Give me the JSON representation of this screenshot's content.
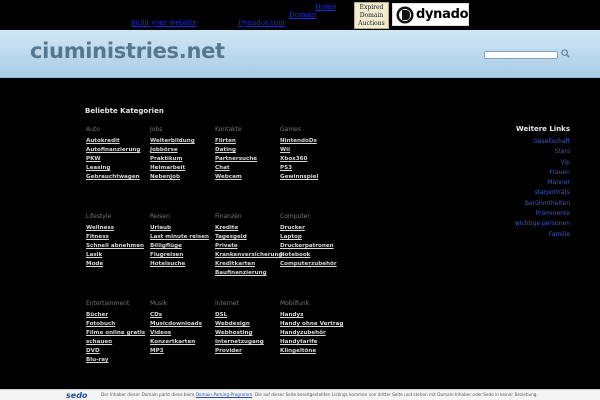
{
  "topbar": {
    "build_link": "build your website",
    "dynadot_link": "Dynadot.com",
    "home_link": "Home",
    "parked_link": "Domain",
    "expired_badge": [
      "Expired",
      "Domain",
      "Auctions"
    ],
    "logo_text": "dynadot"
  },
  "header": {
    "site_title": "ciuministries.net",
    "search_placeholder": ""
  },
  "main": {
    "section_title": "Beliebte Kategorien",
    "rows": [
      [
        {
          "head": "Auto",
          "links": [
            "Autokredit",
            "Autofinanzierung",
            "PKW",
            "Leasing",
            "Gebrauchtwagen"
          ]
        },
        {
          "head": "Jobs",
          "links": [
            "Weiterbildung",
            "Jobbörse",
            "Praktikum",
            "Heimarbeit",
            "Nebenjob"
          ]
        },
        {
          "head": "Kontakte",
          "links": [
            "Flirten",
            "Dating",
            "Partnersuche",
            "Chat",
            "Webcam"
          ]
        },
        {
          "head": "Games",
          "links": [
            "NintendoDs",
            "Wii",
            "Xbox360",
            "PS3",
            "Gewinnspiel"
          ]
        }
      ],
      [
        {
          "head": "Lifestyle",
          "links": [
            "Wellness",
            "Fitness",
            "Schnell abnehmen",
            "Lasik",
            "Mode"
          ]
        },
        {
          "head": "Reisen",
          "links": [
            "Urlaub",
            "Last minute reisen",
            "Billigflüge",
            "Flugreisen",
            "Hotelsuche"
          ]
        },
        {
          "head": "Finanzen",
          "links": [
            "Kredite",
            "Tagesgeld",
            "Private",
            "Krankenversicherung",
            "Kreditkarten",
            "Baufinanzierung"
          ]
        },
        {
          "head": "Computer",
          "links": [
            "Drucker",
            "Laptop",
            "Druckerpatronen",
            "Notebook",
            "Computerzubehör"
          ]
        }
      ],
      [
        {
          "head": "Entertainment",
          "links": [
            "Bücher",
            "Fotobuch",
            "Filme online gratis",
            "schauen",
            "DVD",
            "Blu-ray"
          ]
        },
        {
          "head": "Musik",
          "links": [
            "CDs",
            "Musicdownloads",
            "Videos",
            "Konzertkarten",
            "MP3"
          ]
        },
        {
          "head": "Internet",
          "links": [
            "DSL",
            "Webdesign",
            "Webhosting",
            "Internetzugang",
            "Provider"
          ]
        },
        {
          "head": "Mobilfunk",
          "links": [
            "Handys",
            "Handy ohne Vertrag",
            "Handyzubehör",
            "Handytarife",
            "Klingeltöne"
          ]
        }
      ]
    ]
  },
  "sidebar": {
    "title": "Weitere Links",
    "links": [
      "Gesellschaft",
      "Stars",
      "Vip",
      "Frauen",
      "Männer",
      "starporträts",
      "Berühmtheiten",
      "Prominente",
      "wichtige personen",
      "Familie"
    ]
  },
  "footer": {
    "logo": "sedo",
    "text_before": "Der Inhaber dieser Domain parkt diese beim",
    "link": "Domain-Parking-Programm",
    "text_after": ". Die auf dieser Seite bereitgestellten Listings kommen von dritter Seite und stehen mit Domain-Inhaber oder Sedo in keiner Beziehung."
  },
  "colors": {
    "background": "#000000",
    "header_band": "#bcdcef",
    "site_title": "#56788e",
    "category_head": "#777777",
    "category_link": "#d8d8d8",
    "sidebar_link": "#3a5bc7"
  }
}
